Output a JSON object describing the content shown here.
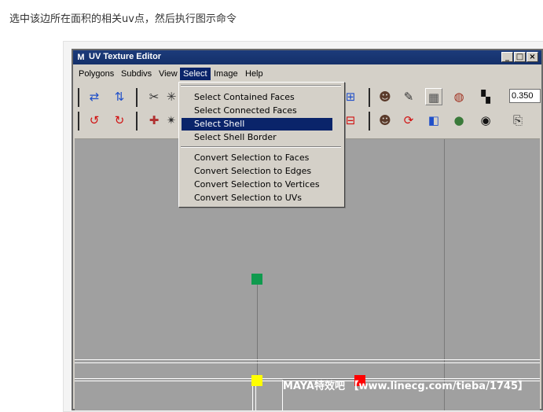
{
  "caption": "选中该边所在面积的相关uv点，然后执行图示命令",
  "window": {
    "title": "UV Texture Editor",
    "buttons": [
      "_",
      "□",
      "×"
    ]
  },
  "menubar": {
    "items": [
      "Polygons",
      "Subdivs",
      "View",
      "Select",
      "Image",
      "Help"
    ],
    "active": "Select"
  },
  "select_menu": {
    "items": [
      "Select Contained Faces",
      "Select Connected Faces",
      "Select Shell",
      "Select Shell Border",
      "Convert Selection to Faces",
      "Convert Selection to Edges",
      "Convert Selection to Vertices",
      "Convert Selection to UVs"
    ],
    "highlighted": "Select Shell"
  },
  "toolbar": {
    "value_field": "0.350"
  },
  "colors": {
    "uv_green": "#0f9a4e",
    "uv_yellow": "#ffff00",
    "uv_red": "#ff0000",
    "highlight": "#0a246a"
  },
  "watermark": "MAYA特效吧 【www.linecg.com/tieba/1745】"
}
